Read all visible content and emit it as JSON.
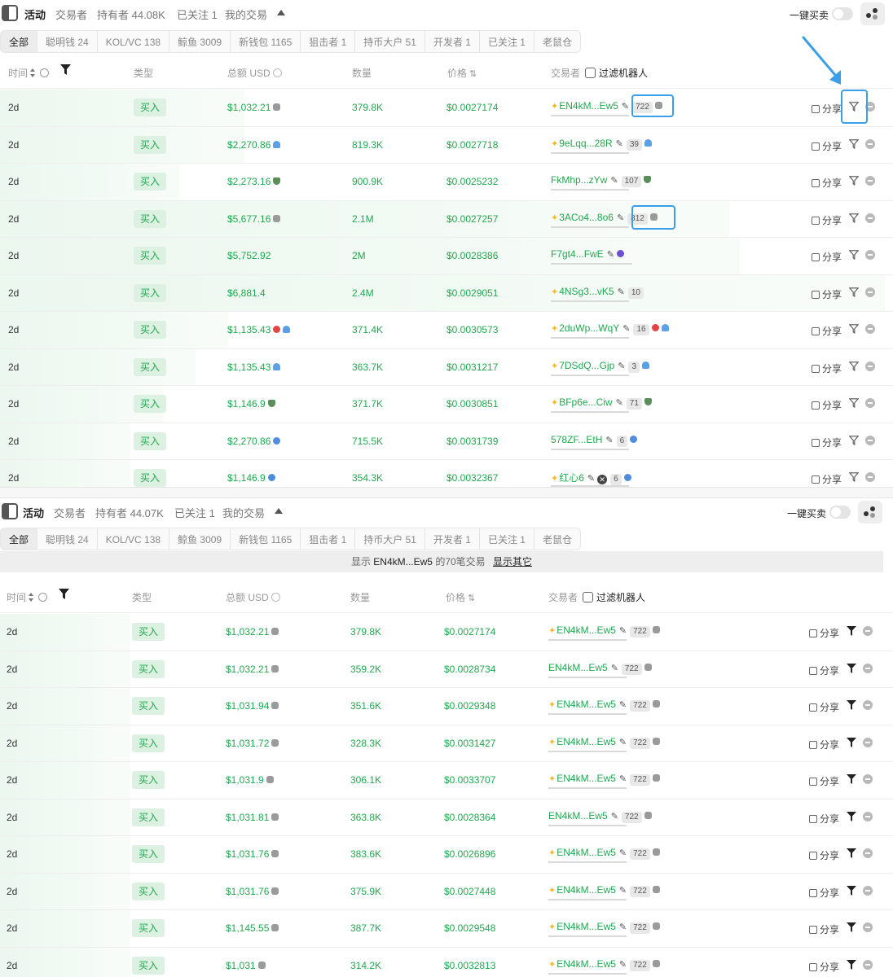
{
  "panel_a": {
    "header_tabs": [
      "活动",
      "交易者",
      "持有者 44.08K",
      "已关注 1",
      "我的交易"
    ],
    "quick_sell_label": "一键买卖",
    "filter_tabs": [
      "全部",
      "聪明钱 24",
      "KOL/VC 138",
      "鲸鱼 3009",
      "新钱包 1165",
      "狙击者 1",
      "持币大户 51",
      "开发者 1",
      "已关注 1",
      "老鼠仓"
    ],
    "columns": {
      "time": "时间",
      "type": "类型",
      "amount": "总额 USD",
      "qty": "数量",
      "price": "价格",
      "trader": "交易者",
      "filter_bots": "过滤机器人"
    },
    "rows": [
      {
        "time": "2d",
        "type": "买入",
        "amount": "$1,032.21",
        "tag": "bot-icon",
        "qty": "379.8K",
        "price": "$0.0027174",
        "trader": "EN4kM...Ew5",
        "sparkle": true,
        "count": "722",
        "trader_tag": "bot-icon",
        "share": "分享"
      },
      {
        "time": "2d",
        "type": "买入",
        "amount": "$2,270.86",
        "tag": "shark-icon",
        "qty": "819.3K",
        "price": "$0.0027718",
        "trader": "9eLqq...28R",
        "sparkle": true,
        "count": "39",
        "trader_tag": "shark-icon",
        "share": "分享"
      },
      {
        "time": "2d",
        "type": "买入",
        "amount": "$2,273.16",
        "tag": "bull-icon",
        "qty": "900.9K",
        "price": "$0.0025232",
        "trader": "FkMhp...zYw",
        "sparkle": false,
        "count": "107",
        "trader_tag": "bull-icon",
        "share": "分享"
      },
      {
        "time": "2d",
        "type": "买入",
        "amount": "$5,677.16",
        "tag": "bot-icon",
        "qty": "2.1M",
        "price": "$0.0027257",
        "trader": "3ACo4...8o6",
        "sparkle": true,
        "count": "812",
        "trader_tag": "bot-icon",
        "share": "分享"
      },
      {
        "time": "2d",
        "type": "买入",
        "amount": "$5,752.92",
        "tag": "",
        "qty": "2M",
        "price": "$0.0028386",
        "trader": "F7gt4...FwE",
        "sparkle": false,
        "count": "",
        "trader_tag": "moon-icon",
        "share": "分享"
      },
      {
        "time": "2d",
        "type": "买入",
        "amount": "$6,881.4",
        "tag": "",
        "qty": "2.4M",
        "price": "$0.0029051",
        "trader": "4NSg3...vK5",
        "sparkle": true,
        "count": "10",
        "trader_tag": "",
        "share": "分享"
      },
      {
        "time": "2d",
        "type": "买入",
        "amount": "$1,135.43",
        "tag": "pill-shark-icon",
        "qty": "371.4K",
        "price": "$0.0030573",
        "trader": "2duWp...WqY",
        "sparkle": true,
        "count": "16",
        "trader_tag": "pill-shark-icon",
        "share": "分享"
      },
      {
        "time": "2d",
        "type": "买入",
        "amount": "$1,135.43",
        "tag": "shark-icon",
        "qty": "363.7K",
        "price": "$0.0031217",
        "trader": "7DSdQ...Gjp",
        "sparkle": true,
        "count": "3",
        "trader_tag": "shark-icon",
        "share": "分享"
      },
      {
        "time": "2d",
        "type": "买入",
        "amount": "$1,146.9",
        "tag": "bull-icon",
        "qty": "371.7K",
        "price": "$0.0030851",
        "trader": "BFp6e...Ciw",
        "sparkle": true,
        "count": "71",
        "trader_tag": "bull-icon",
        "share": "分享"
      },
      {
        "time": "2d",
        "type": "买入",
        "amount": "$2,270.86",
        "tag": "fish-icon",
        "qty": "715.5K",
        "price": "$0.0031739",
        "trader": "578ZF...EtH",
        "sparkle": false,
        "count": "6",
        "trader_tag": "fish-icon",
        "share": "分享"
      },
      {
        "time": "2d",
        "type": "买入",
        "amount": "$1,146.9",
        "tag": "fish-icon",
        "qty": "354.3K",
        "price": "$0.0032367",
        "trader": "红心6",
        "sparkle": true,
        "count": "6",
        "trader_tag": "fish-icon",
        "share": "分享"
      }
    ]
  },
  "panel_b": {
    "header_tabs": [
      "活动",
      "交易者",
      "持有者 44.07K",
      "已关注 1",
      "我的交易"
    ],
    "quick_sell_label": "一键买卖",
    "filter_tabs": [
      "全部",
      "聪明钱 24",
      "KOL/VC 138",
      "鲸鱼 3009",
      "新钱包 1165",
      "狙击者 1",
      "持币大户 51",
      "开发者 1",
      "已关注 1",
      "老鼠仓"
    ],
    "banner": {
      "prefix": "显示",
      "address": "EN4kM...Ew5",
      "suffix": "的70笔交易",
      "show_other": "显示其它"
    },
    "columns": {
      "time": "时间",
      "type": "类型",
      "amount": "总额 USD",
      "qty": "数量",
      "price": "价格",
      "trader": "交易者",
      "filter_bots": "过滤机器人"
    },
    "rows": [
      {
        "time": "2d",
        "type": "买入",
        "amount": "$1,032.21",
        "qty": "379.8K",
        "price": "$0.0027174",
        "trader": "EN4kM...Ew5",
        "sparkle": true,
        "count": "722",
        "share": "分享"
      },
      {
        "time": "2d",
        "type": "买入",
        "amount": "$1,032.21",
        "qty": "359.2K",
        "price": "$0.0028734",
        "trader": "EN4kM...Ew5",
        "sparkle": false,
        "count": "722",
        "share": "分享"
      },
      {
        "time": "2d",
        "type": "买入",
        "amount": "$1,031.94",
        "qty": "351.6K",
        "price": "$0.0029348",
        "trader": "EN4kM...Ew5",
        "sparkle": true,
        "count": "722",
        "share": "分享"
      },
      {
        "time": "2d",
        "type": "买入",
        "amount": "$1,031.72",
        "qty": "328.3K",
        "price": "$0.0031427",
        "trader": "EN4kM...Ew5",
        "sparkle": true,
        "count": "722",
        "share": "分享"
      },
      {
        "time": "2d",
        "type": "买入",
        "amount": "$1,031.9",
        "qty": "306.1K",
        "price": "$0.0033707",
        "trader": "EN4kM...Ew5",
        "sparkle": true,
        "count": "722",
        "share": "分享"
      },
      {
        "time": "2d",
        "type": "买入",
        "amount": "$1,031.81",
        "qty": "363.8K",
        "price": "$0.0028364",
        "trader": "EN4kM...Ew5",
        "sparkle": false,
        "count": "722",
        "share": "分享"
      },
      {
        "time": "2d",
        "type": "买入",
        "amount": "$1,031.76",
        "qty": "383.6K",
        "price": "$0.0026896",
        "trader": "EN4kM...Ew5",
        "sparkle": true,
        "count": "722",
        "share": "分享"
      },
      {
        "time": "2d",
        "type": "买入",
        "amount": "$1,031.76",
        "qty": "375.9K",
        "price": "$0.0027448",
        "trader": "EN4kM...Ew5",
        "sparkle": true,
        "count": "722",
        "share": "分享"
      },
      {
        "time": "2d",
        "type": "买入",
        "amount": "$1,145.55",
        "qty": "387.7K",
        "price": "$0.0029548",
        "trader": "EN4kM...Ew5",
        "sparkle": true,
        "count": "722",
        "share": "分享"
      },
      {
        "time": "2d",
        "type": "买入",
        "amount": "$1,031",
        "qty": "314.2K",
        "price": "$0.0032813",
        "trader": "EN4kM...Ew5",
        "sparkle": true,
        "count": "722",
        "share": "分享"
      }
    ]
  },
  "colors": {
    "buy_green": "#21a84f",
    "annotation_blue": "#3a9fe8"
  }
}
